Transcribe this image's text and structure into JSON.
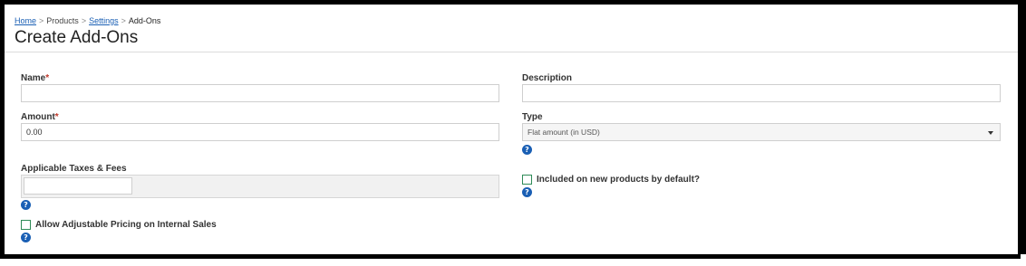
{
  "breadcrumb": {
    "home": "Home",
    "products": "Products",
    "settings": "Settings",
    "current": "Add-Ons",
    "separator": ">"
  },
  "page_title": "Create Add-Ons",
  "form": {
    "name": {
      "label": "Name",
      "required_mark": "*",
      "value": ""
    },
    "description": {
      "label": "Description",
      "value": ""
    },
    "amount": {
      "label": "Amount",
      "required_mark": "*",
      "value": "0.00"
    },
    "type": {
      "label": "Type",
      "selected": "Flat amount (in USD)"
    },
    "taxes": {
      "label": "Applicable Taxes & Fees",
      "value": ""
    },
    "included_default": {
      "label": "Included on new products by default?",
      "checked": false
    },
    "adjustable_pricing": {
      "label": "Allow Adjustable Pricing on Internal Sales",
      "checked": false
    }
  },
  "icons": {
    "help": "?"
  },
  "colors": {
    "link": "#1a5fb4",
    "required": "#c0392b",
    "help_icon": "#1a5fb4",
    "checkbox_border": "#2e8b57"
  }
}
